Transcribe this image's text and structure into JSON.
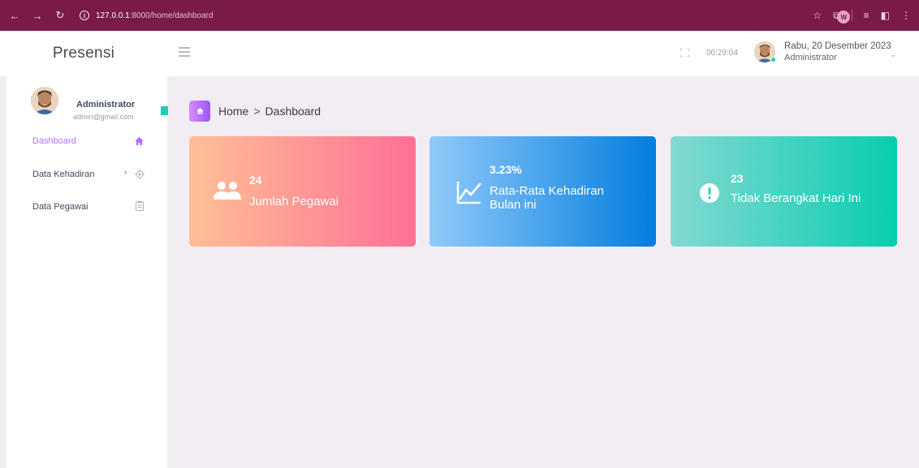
{
  "browser": {
    "url_host": "127.0.0.1",
    "url_path": ":8000/home/dashboard",
    "profile_initial": "W"
  },
  "header": {
    "brand": "Presensi",
    "clock": "00:29:04",
    "date": "Rabu, 20 Desember 2023",
    "role": "Administrator"
  },
  "sidebar": {
    "profile": {
      "name": "Administrator",
      "email": "admin@gmail.com"
    },
    "items": [
      {
        "label": "Dashboard",
        "icon": "home-icon"
      },
      {
        "label": "Data Kehadiran",
        "icon": "crosshair-icon"
      },
      {
        "label": "Data Pegawai",
        "icon": "contact-card-icon"
      }
    ]
  },
  "breadcrumb": {
    "home": "Home",
    "separator": ">",
    "current": "Dashboard"
  },
  "cards": [
    {
      "value": "24",
      "label": "Jumlah Pegawai",
      "icon": "users-icon",
      "colors": [
        "#ffbf96",
        "#fe7096"
      ]
    },
    {
      "value": "3.23%",
      "label_line1": "Rata-Rata Kehadiran",
      "label_line2": "Bulan ini",
      "icon": "chart-line-icon",
      "colors": [
        "#90caf9",
        "#047edf"
      ]
    },
    {
      "value": "23",
      "label": "Tidak Berangkat Hari Ini",
      "icon": "alert-circle-icon",
      "colors": [
        "#84d9d2",
        "#07cdae"
      ]
    }
  ],
  "colors": {
    "accent": "#b66dff",
    "chrome": "#7a1a48",
    "content_bg": "#f2edf3"
  }
}
